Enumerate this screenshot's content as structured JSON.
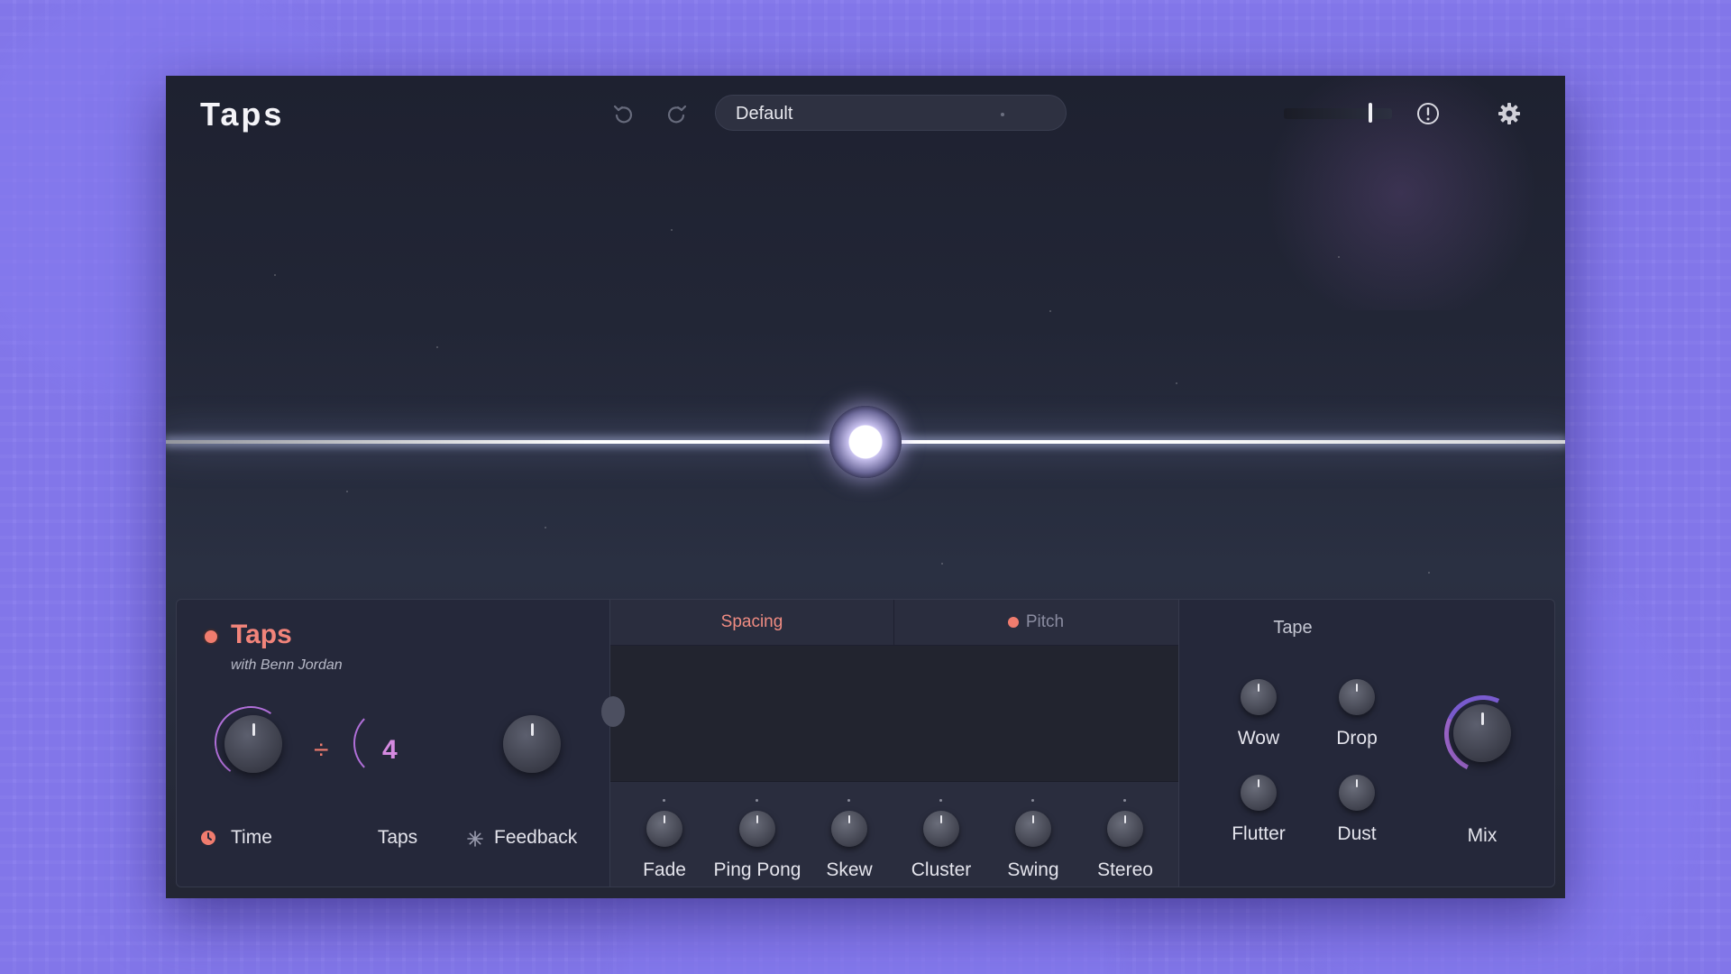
{
  "app": {
    "title": "Taps"
  },
  "header": {
    "preset": "Default",
    "output_level": 0.78
  },
  "module": {
    "title": "Taps",
    "subtitle": "with Benn Jordan",
    "time_label": "Time",
    "divide_symbol": "÷",
    "taps_value": "4",
    "taps_label": "Taps",
    "feedback_label": "Feedback"
  },
  "tabs": {
    "spacing": "Spacing",
    "pitch": "Pitch"
  },
  "spacing_knobs": [
    "Fade",
    "Ping Pong",
    "Skew",
    "Cluster",
    "Swing",
    "Stereo"
  ],
  "tape": {
    "title": "Tape",
    "knobs": [
      "Wow",
      "Drop",
      "Flutter",
      "Dust"
    ],
    "mix_label": "Mix"
  },
  "colors": {
    "accent": "#f07c6e",
    "taps_purple": "#d58ae0",
    "background": "#8c80ee",
    "panel": "#25283a"
  }
}
